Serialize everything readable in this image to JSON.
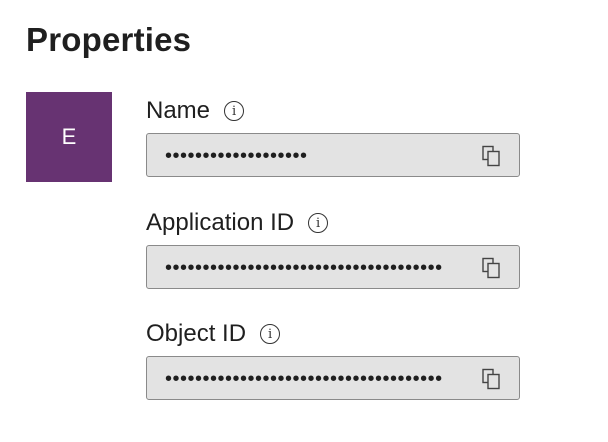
{
  "title": "Properties",
  "avatar": {
    "initial": "E",
    "color": "#673372"
  },
  "fields": [
    {
      "label": "Name",
      "value": "•••••••••••••••••••"
    },
    {
      "label": "Application ID",
      "value": "•••••••••••••••••••••••••••••••••••••"
    },
    {
      "label": "Object ID",
      "value": "•••••••••••••••••••••••••••••••••••••"
    }
  ],
  "icons": {
    "info": "info-icon",
    "copy": "copy-icon"
  }
}
